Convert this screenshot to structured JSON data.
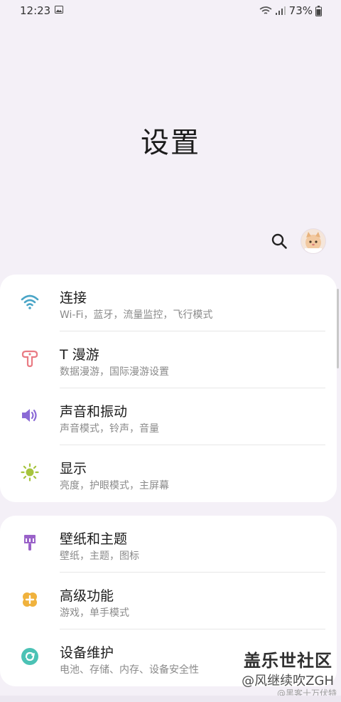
{
  "status_bar": {
    "time": "12:23",
    "battery": "73%"
  },
  "title": "设置",
  "header_actions": {
    "search_icon": "search-icon",
    "avatar": "avatar"
  },
  "cards": [
    {
      "items": [
        {
          "title": "连接",
          "subtitle": "Wi-Fi，蓝牙，流量监控，飞行模式",
          "icon": "wifi-icon",
          "color": "#4aa5c7"
        },
        {
          "title": "T 漫游",
          "subtitle": "数据漫游，国际漫游设置",
          "icon": "roaming-icon",
          "color": "#e97b84"
        },
        {
          "title": "声音和振动",
          "subtitle": "声音模式，铃声，音量",
          "icon": "volume-icon",
          "color": "#8b6ad6"
        },
        {
          "title": "显示",
          "subtitle": "亮度，护眼模式，主屏幕",
          "icon": "brightness-icon",
          "color": "#a6c43d"
        }
      ]
    },
    {
      "items": [
        {
          "title": "壁纸和主题",
          "subtitle": "壁纸，主题，图标",
          "icon": "brush-icon",
          "color": "#9a62c9"
        },
        {
          "title": "高级功能",
          "subtitle": "游戏，单手模式",
          "icon": "advanced-features-icon",
          "color": "#f0b23d"
        },
        {
          "title": "设备维护",
          "subtitle": "电池、存储、内存、设备安全性",
          "icon": "device-care-icon",
          "color": "#4bc2b5"
        }
      ]
    }
  ],
  "watermark": {
    "line1": "盖乐世社区",
    "line2": "@风继续吹ZGH",
    "line3": "@黑客十万伏特"
  }
}
